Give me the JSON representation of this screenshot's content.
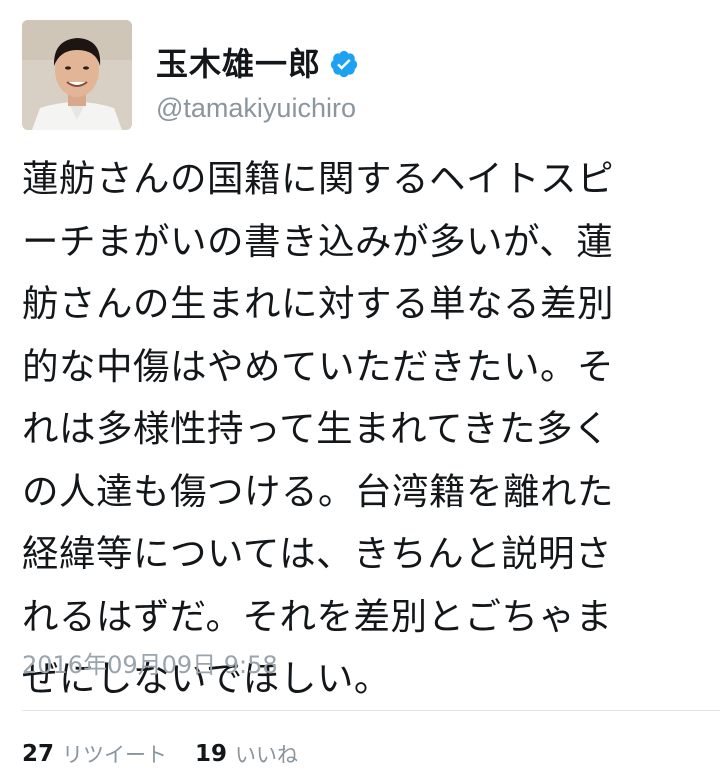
{
  "user": {
    "display_name": "玉木雄一郎",
    "handle": "@tamakiyuichiro",
    "verified_icon": "verified-badge-icon",
    "avatar_icon": "profile-photo"
  },
  "tweet": {
    "lines": [
      "蓮舫さんの国籍に関するヘイトスピ",
      "ーチまがいの書き込みが多いが、蓮",
      "舫さんの生まれに対する単なる差別",
      "的な中傷はやめていただきたい。そ",
      "れは多様性持って生まれてきた多く",
      "の人達も傷つける。台湾籍を離れた",
      "経緯等については、きちんと説明さ",
      "れるはずだ。それを差別とごちゃま",
      "ぜにしないでほしい。"
    ],
    "timestamp": "2016年09月09日 9:58"
  },
  "stats": {
    "retweet_count": "27",
    "retweet_label": "リツイート",
    "like_count": "19",
    "like_label": "いいね"
  },
  "colors": {
    "text": "#14171a",
    "muted": "#8a959e",
    "verified": "#1da1f2",
    "divider": "#e1e8ed"
  }
}
